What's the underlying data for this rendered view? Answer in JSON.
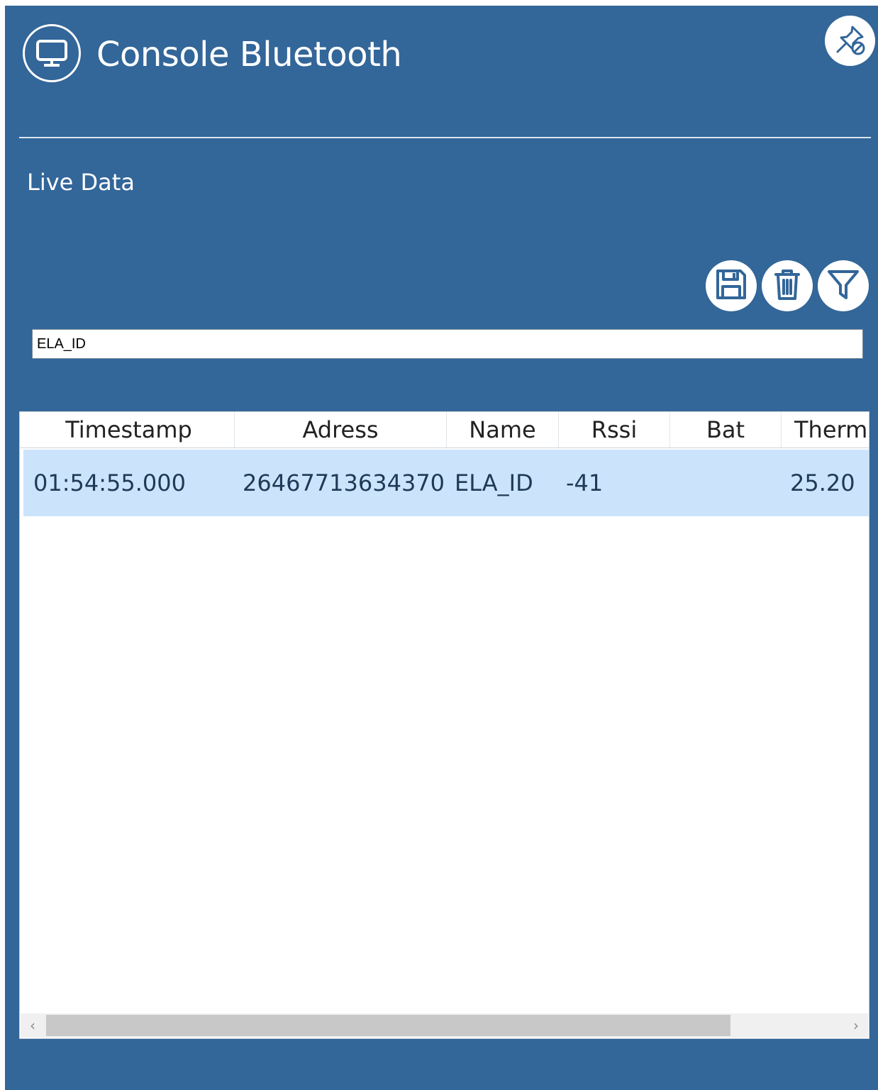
{
  "header": {
    "title": "Console Bluetooth",
    "icon": "monitor-icon",
    "pin_icon": "unpin-icon"
  },
  "section": {
    "label": "Live Data"
  },
  "toolbar": {
    "buttons": [
      {
        "name": "save",
        "icon": "floppy-disk-icon"
      },
      {
        "name": "delete",
        "icon": "trash-icon"
      },
      {
        "name": "filter",
        "icon": "funnel-icon"
      }
    ]
  },
  "filter": {
    "value": "ELA_ID"
  },
  "table": {
    "columns": [
      "Timestamp",
      "Adress",
      "Name",
      "Rssi",
      "Bat",
      "Therm"
    ],
    "rows": [
      {
        "timestamp": "01:54:55.000",
        "address": "26467713634370",
        "name": "ELA_ID",
        "rssi": "-41",
        "bat": "",
        "therm": "25.20"
      }
    ]
  },
  "scrollbar": {
    "left_arrow": "‹",
    "right_arrow": "›"
  },
  "colors": {
    "panel": "#336699",
    "selected_row": "#cce4fb",
    "text_white": "#ffffff"
  }
}
